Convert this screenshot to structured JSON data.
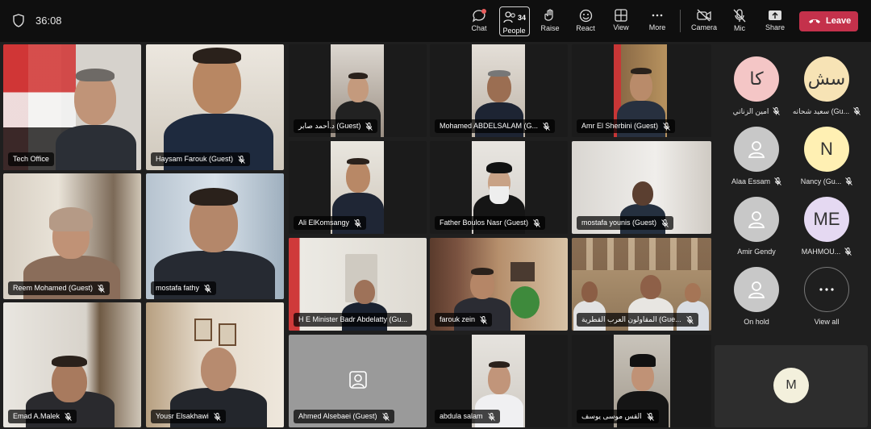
{
  "toolbar": {
    "timer": "36:08",
    "chat_label": "Chat",
    "people_label": "People",
    "people_count": "34",
    "raise_label": "Raise",
    "react_label": "React",
    "view_label": "View",
    "more_label": "More",
    "camera_label": "Camera",
    "mic_label": "Mic",
    "share_label": "Share",
    "leave_label": "Leave"
  },
  "participants": [
    "Tech Office",
    "Haysam Farouk (Guest)",
    "د.أحمد صابر (Guest)",
    "Mohamed ABDELSALAM (G...",
    "Amr El Sherbini (Guest)",
    "Ali ElKomsangy",
    "Father Boulos Nasr (Guest)",
    "mostafa younis (Guest)",
    "Reem Mohamed (Guest)",
    "mostafa fathy",
    "H E Minister Badr Abdelatty (Gu...",
    "farouk zein",
    "المقاولون العرب القطرية (Gue...",
    "Emad A.Malek",
    "Yousr Elsakhawi",
    "Ahmed Alsebaei (Guest)",
    "abdula salam",
    "القس موسى يوسف"
  ],
  "panel": [
    {
      "initials": "كا",
      "name": "امين الزناتي",
      "color": "#f4c6c6"
    },
    {
      "initials": "سش",
      "name": "سعيد شحاته (Gu...",
      "color": "#f7e3b5"
    },
    {
      "initials": "",
      "name": "Alaa Essam",
      "color": "#c8c8c8"
    },
    {
      "initials": "N",
      "name": "Nancy (Gu...",
      "color": "#fff0b3"
    },
    {
      "initials": "",
      "name": "Amir Gendy",
      "color": "#c8c8c8"
    },
    {
      "initials": "ME",
      "name": "MAHMOU...",
      "color": "#e5d9f2"
    },
    {
      "initials": "",
      "name": "On hold",
      "color": "#c8c8c8"
    },
    {
      "initials": "",
      "name": "View all",
      "color": "#1f1f1f"
    }
  ],
  "bottom_right": {
    "initials": "M"
  }
}
